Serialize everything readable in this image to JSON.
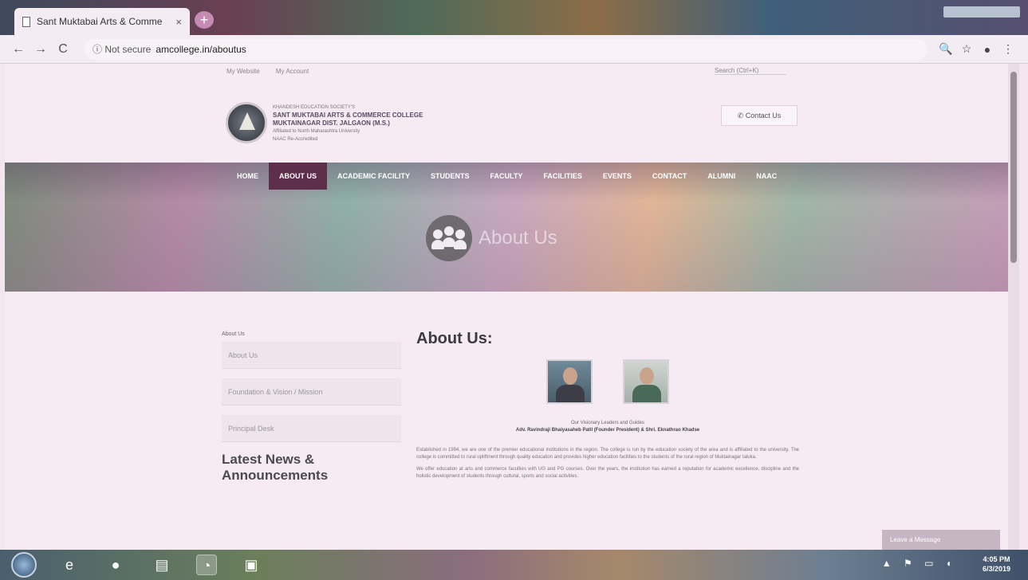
{
  "browser": {
    "tab_title": "Sant Muktabai Arts & Comme",
    "tab_close": "×",
    "new_tab": "+",
    "back": "←",
    "forward": "→",
    "reload": "C",
    "security_label": "ⓘ Not secure",
    "url": "amcollege.in/aboutus",
    "zoom": "🔍",
    "bookmark": "☆",
    "account": "●",
    "menu": "⋮"
  },
  "page": {
    "top_links": [
      "My Website",
      "My Account"
    ],
    "search_placeholder": "Search (Ctrl+K)",
    "college": {
      "line1": "KHANDESH EDUCATION SOCIETY'S",
      "name": "SANT MUKTABAI ARTS & COMMERCE COLLEGE",
      "line3": "MUKTAINAGAR DIST. JALGAON (M.S.)",
      "line4": "Affiliated to North Maharashtra University",
      "line5": "NAAC Re-Accredited"
    },
    "contact_button": "Contact Us",
    "nav": [
      "HOME",
      "ABOUT US",
      "ACADEMIC FACILITY",
      "STUDENTS",
      "FACULTY",
      "FACILITIES",
      "EVENTS",
      "CONTACT",
      "ALUMNI",
      "NAAC"
    ],
    "banner_title": "About Us",
    "sidebar": {
      "heading": "About Us",
      "items": [
        "About Us",
        "Foundation & Vision / Mission",
        "Principal Desk"
      ],
      "news_title": "Latest News & Announcements"
    },
    "content": {
      "title": "About Us:",
      "caption_line1": "Our Visionary Leaders and Guides",
      "caption_line2": "Adv. Ravindraji Bhaiyasaheb Patil (Founder President) & Shri. Eknathrao Khadse",
      "para1": "Established in 1994, we are one of the premier educational institutions in the region. The college is run by the education society of the area and is affiliated to the university. The college is committed to rural upliftment through quality education and provides higher education facilities to the students of the rural region of Muktainagar taluka.",
      "para2": "We offer education at arts and commerce faculties with UG and PG courses. Over the years, the institution has earned a reputation for academic excellence, discipline and the holistic development of students through cultural, sports and social activities."
    },
    "chat_label": "Leave a Message"
  },
  "taskbar": {
    "icons": [
      "◉",
      "e",
      "●",
      "▤",
      "◔",
      "▣"
    ],
    "tray": "▲ ⚑ ▭ ◖",
    "time": "4:05 PM",
    "date": "6/3/2019"
  }
}
